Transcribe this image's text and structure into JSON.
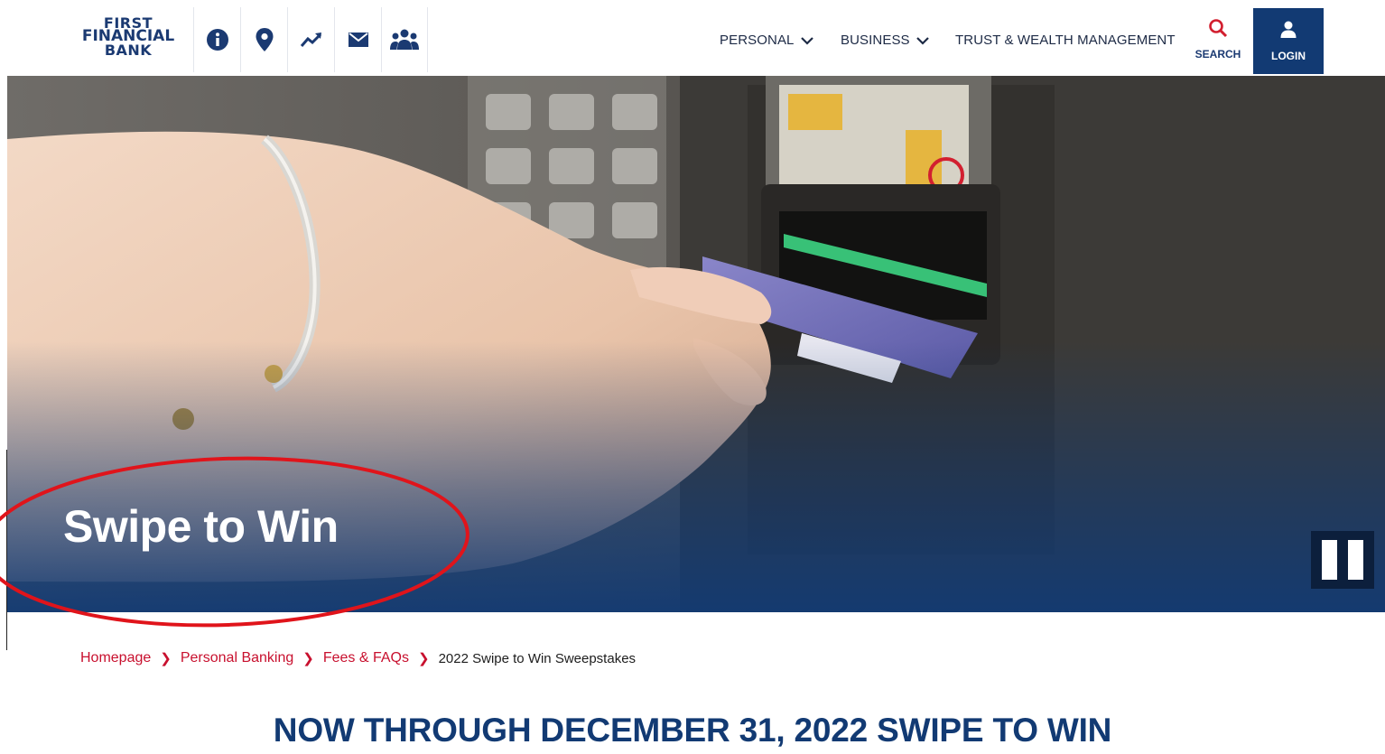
{
  "header": {
    "logo": {
      "line1": "FIRST",
      "line2": "FINANCIAL",
      "line3": "BANK"
    },
    "icons": [
      "info-icon",
      "location-pin-icon",
      "trend-icon",
      "mail-icon",
      "people-icon"
    ],
    "nav": [
      {
        "label": "PERSONAL",
        "has_dropdown": true
      },
      {
        "label": "BUSINESS",
        "has_dropdown": true
      },
      {
        "label": "TRUST & WEALTH MANAGEMENT",
        "has_dropdown": false
      }
    ],
    "search_label": "SEARCH",
    "login_label": "LOGIN"
  },
  "hero": {
    "title": "Swipe to Win"
  },
  "breadcrumb": {
    "items": [
      "Homepage",
      "Personal Banking",
      "Fees & FAQs"
    ],
    "current": "2022 Swipe to Win Sweepstakes"
  },
  "main": {
    "heading": "NOW THROUGH DECEMBER 31, 2022 SWIPE TO WIN"
  },
  "colors": {
    "brand_navy": "#123a73",
    "brand_red": "#c8102e",
    "annotation_red": "#e0141b"
  }
}
